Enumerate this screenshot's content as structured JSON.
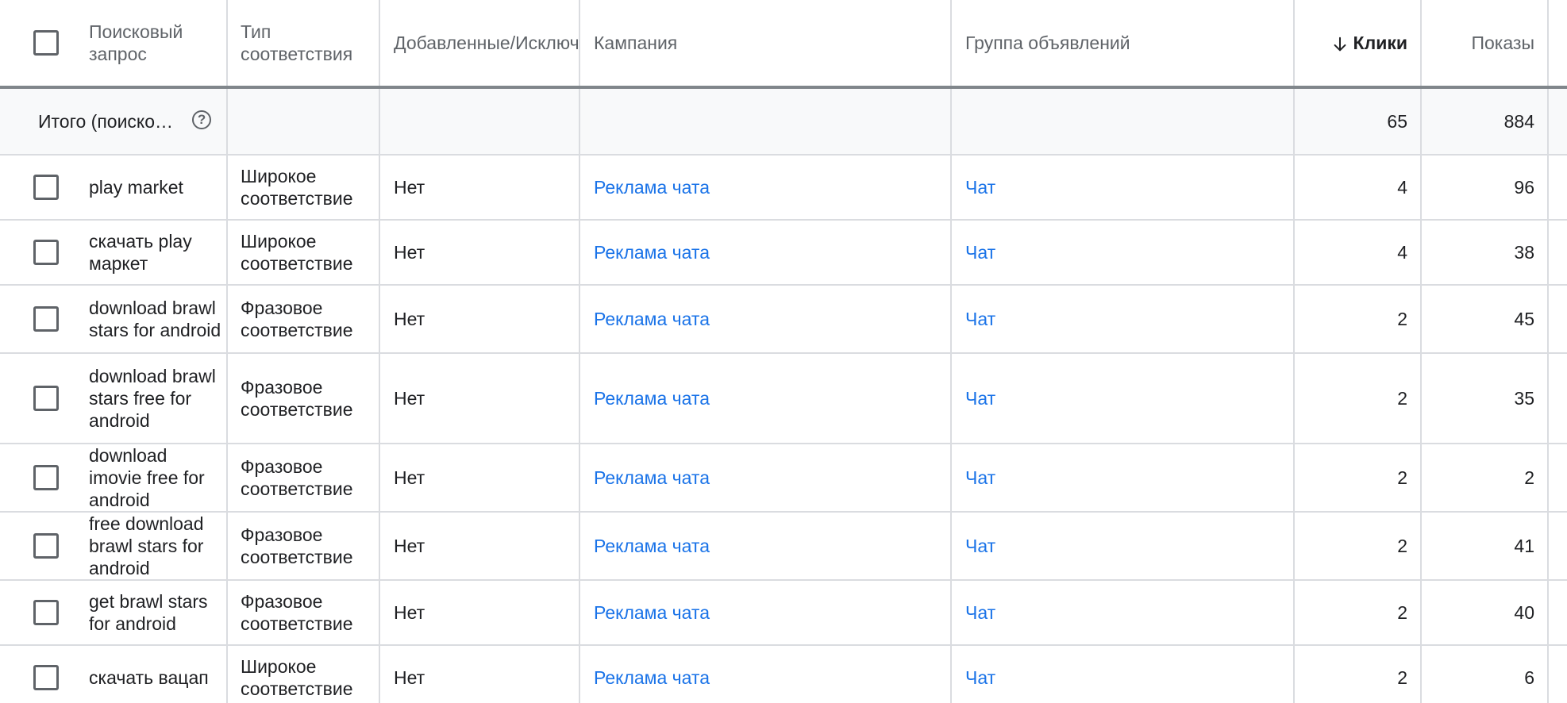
{
  "header": {
    "query": "Поисковый запрос",
    "match_type": "Тип соответствия",
    "added_excluded": "Добавленные/Исключенные",
    "campaign": "Кампания",
    "ad_group": "Группа объявлений",
    "clicks": "Клики",
    "impressions": "Показы",
    "sort_icon": "arrow-down-icon"
  },
  "total": {
    "label": "Итого (поиско…",
    "help_icon": "?",
    "clicks": "65",
    "impressions": "884"
  },
  "rows": [
    {
      "query": "play market",
      "match_type": "Широкое соответствие",
      "added": "Нет",
      "campaign": "Реклама чата",
      "ad_group": "Чат",
      "clicks": "4",
      "impressions": "96"
    },
    {
      "query": "скачать play маркет",
      "match_type": "Широкое соответствие",
      "added": "Нет",
      "campaign": "Реклама чата",
      "ad_group": "Чат",
      "clicks": "4",
      "impressions": "38"
    },
    {
      "query": "download brawl stars for android",
      "match_type": "Фразовое соответствие",
      "added": "Нет",
      "campaign": "Реклама чата",
      "ad_group": "Чат",
      "clicks": "2",
      "impressions": "45"
    },
    {
      "query": "download brawl stars free for android",
      "match_type": "Фразовое соответствие",
      "added": "Нет",
      "campaign": "Реклама чата",
      "ad_group": "Чат",
      "clicks": "2",
      "impressions": "35"
    },
    {
      "query": "download imovie free for android",
      "match_type": "Фразовое соответствие",
      "added": "Нет",
      "campaign": "Реклама чата",
      "ad_group": "Чат",
      "clicks": "2",
      "impressions": "2"
    },
    {
      "query": "free download brawl stars for android",
      "match_type": "Фразовое соответствие",
      "added": "Нет",
      "campaign": "Реклама чата",
      "ad_group": "Чат",
      "clicks": "2",
      "impressions": "41"
    },
    {
      "query": "get brawl stars for android",
      "match_type": "Фразовое соответствие",
      "added": "Нет",
      "campaign": "Реклама чата",
      "ad_group": "Чат",
      "clicks": "2",
      "impressions": "40"
    },
    {
      "query": "скачать вацап",
      "match_type": "Широкое соответствие",
      "added": "Нет",
      "campaign": "Реклама чата",
      "ad_group": "Чат",
      "clicks": "2",
      "impressions": "6"
    }
  ],
  "colors": {
    "link": "#1a73e8",
    "text": "#202124",
    "muted": "#5f6368",
    "border": "#dadce0",
    "total_bg": "#f8f9fa"
  }
}
